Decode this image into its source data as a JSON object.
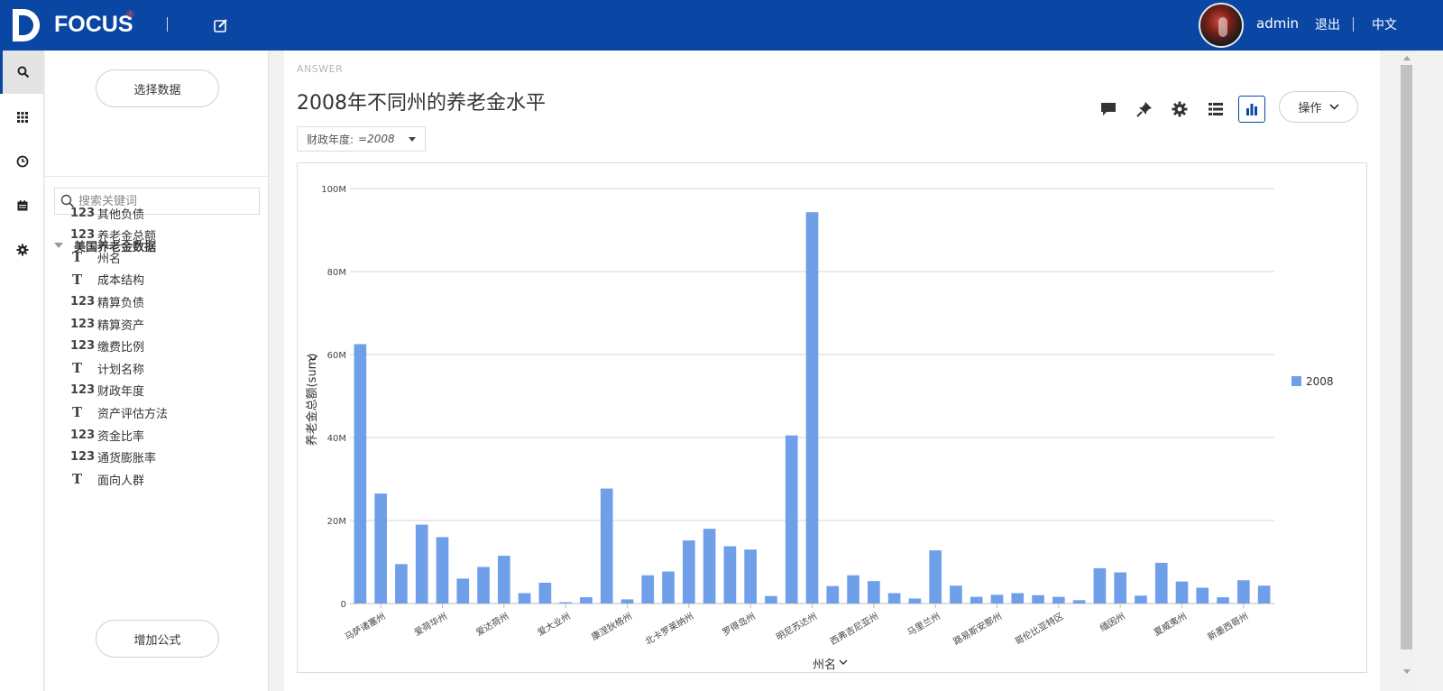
{
  "header": {
    "logo_text": "FOCUS",
    "logo_reg": "®",
    "user_name": "admin",
    "logout_label": "退出",
    "language_label": "中文",
    "brand_color": "#0a46a3"
  },
  "rail": {
    "items": [
      {
        "icon": "search-icon",
        "active": true
      },
      {
        "icon": "grid-icon",
        "active": false
      },
      {
        "icon": "clock-icon",
        "active": false
      },
      {
        "icon": "calendar-icon",
        "active": false
      },
      {
        "icon": "gear-icon",
        "active": false
      }
    ]
  },
  "panel": {
    "select_data_label": "选择数据",
    "search_placeholder": "搜索关键词",
    "dataset_name": "美国养老金数据",
    "fields": [
      {
        "type": "123",
        "name": "其他负债"
      },
      {
        "type": "123",
        "name": "养老金总额"
      },
      {
        "type": "T",
        "name": "州名"
      },
      {
        "type": "T",
        "name": "成本结构"
      },
      {
        "type": "123",
        "name": "精算负债"
      },
      {
        "type": "123",
        "name": "精算资产"
      },
      {
        "type": "123",
        "name": "缴费比例"
      },
      {
        "type": "T",
        "name": "计划名称"
      },
      {
        "type": "123",
        "name": "财政年度"
      },
      {
        "type": "T",
        "name": "资产评估方法"
      },
      {
        "type": "123",
        "name": "资金比率"
      },
      {
        "type": "123",
        "name": "通货膨胀率"
      },
      {
        "type": "T",
        "name": "面向人群"
      }
    ],
    "add_formula_label": "增加公式"
  },
  "answer": {
    "section_label": "ANSWER",
    "title": "2008年不同州的养老金水平",
    "filter_label": "财政年度:",
    "filter_value": "=2008",
    "toolbar_icons": [
      "comment-icon",
      "pin-icon",
      "settings-icon",
      "table-view-icon",
      "chart-view-icon"
    ],
    "operations_label": "操作"
  },
  "chart_data": {
    "type": "bar",
    "title": "",
    "xlabel": "州名",
    "ylabel": "养老金总额(sum)",
    "ylim": [
      0,
      100000000
    ],
    "y_ticks": [
      "0",
      "20M",
      "40M",
      "60M",
      "80M",
      "100M"
    ],
    "grid": true,
    "legend_position": "right",
    "bar_color": "#6f9fe9",
    "x_tick_labels": [
      "马萨诸塞州",
      "爱荷华州",
      "爱达荷州",
      "爱大业州",
      "康涅狄格州",
      "北卡罗莱纳州",
      "罗得岛州",
      "明尼苏达州",
      "西弗吉尼亚州",
      "马里兰州",
      "路易斯安那州",
      "哥伦比亚特区",
      "缅因州",
      "夏威夷州",
      "新墨西哥州"
    ],
    "series": [
      {
        "name": "2008",
        "values": [
          62500000,
          26500000,
          9500000,
          19000000,
          16000000,
          6000000,
          8800000,
          11500000,
          2500000,
          5000000,
          300000,
          1500000,
          27700000,
          1000000,
          6800000,
          7700000,
          15200000,
          18000000,
          13800000,
          13000000,
          1800000,
          40500000,
          94300000,
          4200000,
          6800000,
          5400000,
          2500000,
          1200000,
          12800000,
          4300000,
          1600000,
          2100000,
          2500000,
          2000000,
          1600000,
          800000,
          8500000,
          7500000,
          1900000,
          9800000,
          5300000,
          3800000,
          1500000,
          5600000,
          4300000
        ]
      }
    ]
  }
}
